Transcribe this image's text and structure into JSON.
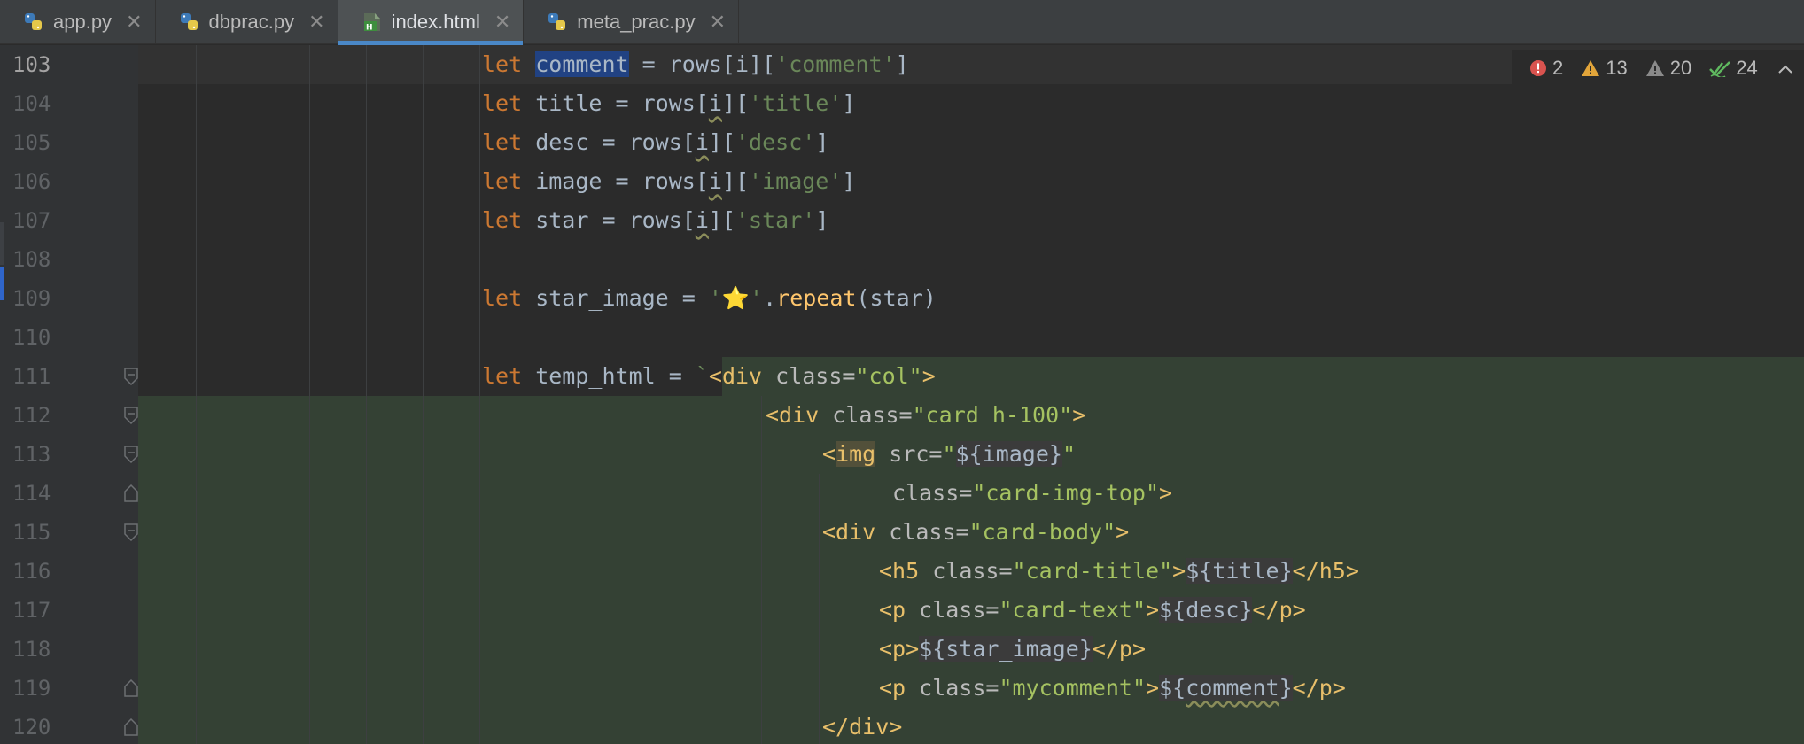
{
  "tabs": [
    {
      "label": "app.py",
      "icon": "python-file-icon",
      "active": false
    },
    {
      "label": "dbprac.py",
      "icon": "python-file-icon",
      "active": false
    },
    {
      "label": "index.html",
      "icon": "html-file-icon",
      "active": true
    },
    {
      "label": "meta_prac.py",
      "icon": "python-file-icon",
      "active": false
    }
  ],
  "tab_close_glyph": "✕",
  "inspections": {
    "errors": "2",
    "warnings": "13",
    "weak_warnings": "20",
    "typos": "24"
  },
  "line_numbers": [
    "103",
    "104",
    "105",
    "106",
    "107",
    "108",
    "109",
    "110",
    "111",
    "112",
    "113",
    "114",
    "115",
    "116",
    "117",
    "118",
    "119",
    "120"
  ],
  "code": {
    "l103": {
      "kw": "let",
      "var": "comment",
      "rest1": " = rows[i][",
      "str": "'comment'",
      "rest2": "]"
    },
    "l104": {
      "kw": "let",
      "pre": " title = rows[",
      "i": "i",
      "mid": "][",
      "str": "'title'",
      "post": "]"
    },
    "l105": {
      "kw": "let",
      "pre": " desc = rows[",
      "i": "i",
      "mid": "][",
      "str": "'desc'",
      "post": "]"
    },
    "l106": {
      "kw": "let",
      "pre": " image = rows[",
      "i": "i",
      "mid": "][",
      "str": "'image'",
      "post": "]"
    },
    "l107": {
      "kw": "let",
      "pre": " star = rows[",
      "i": "i",
      "mid": "][",
      "str": "'star'",
      "post": "]"
    },
    "l109": {
      "kw": "let",
      "pre": " star_image = ",
      "str": "'⭐'",
      "dot": ".",
      "fn": "repeat",
      "args": "(star)"
    },
    "l111": {
      "kw": "let",
      "pre": " temp_html = ",
      "tick": "`",
      "tag": "<div ",
      "attr": "class=",
      "val": "\"col\"",
      "close": ">"
    },
    "l112": {
      "tag": "<div ",
      "attr": "class=",
      "val": "\"card h-100\"",
      "close": ">"
    },
    "l113": {
      "lt": "<",
      "tag": "img",
      "attr": " src=",
      "q1": "\"",
      "interp": "${image}",
      "q2": "\""
    },
    "l114": {
      "attr": "class=",
      "val": "\"card-img-top\"",
      "close": ">"
    },
    "l115": {
      "tag": "<div ",
      "attr": "class=",
      "val": "\"card-body\"",
      "close": ">"
    },
    "l116": {
      "tag": "<h5 ",
      "attr": "class=",
      "val": "\"card-title\"",
      "gt": ">",
      "interp": "${title}",
      "end": "</h5>"
    },
    "l117": {
      "tag": "<p ",
      "attr": "class=",
      "val": "\"card-text\"",
      "gt": ">",
      "interp": "${desc}",
      "end": "</p>"
    },
    "l118": {
      "tag": "<p>",
      "interp": "${star_image}",
      "end": "</p>"
    },
    "l119": {
      "tag": "<p ",
      "attr": "class=",
      "val": "\"mycomment\"",
      "gt": ">",
      "interp_a": "${",
      "interp_b": "comment",
      "interp_c": "}",
      "end": "</p>"
    },
    "l120": {
      "end": "</div>"
    }
  }
}
